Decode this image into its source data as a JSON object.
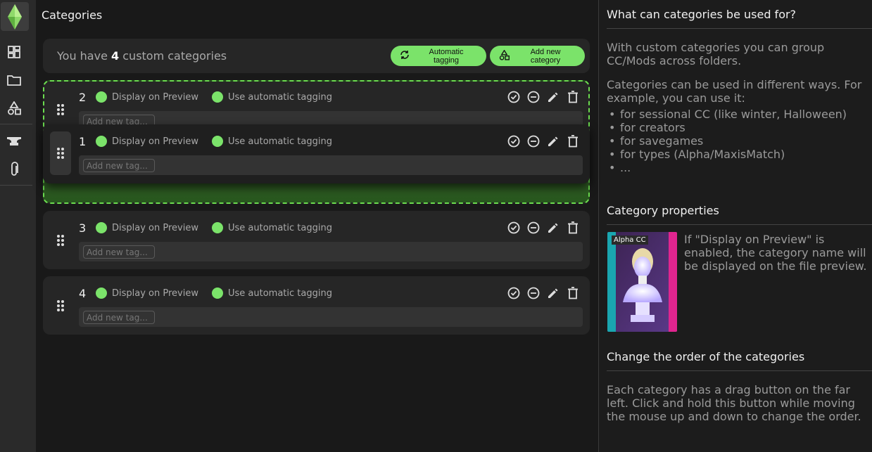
{
  "sidebar": {
    "icons": [
      "sims-logo-icon",
      "dashboard-icon",
      "folder-icon",
      "shapes-icon",
      "anvil-icon",
      "paperclip-icon"
    ]
  },
  "main": {
    "title": "Categories",
    "summary_prefix": "You have",
    "summary_count": "4",
    "summary_suffix": "custom categories",
    "auto_tag_label": "Automatic tagging",
    "add_category_label": "Add new category"
  },
  "categories": [
    {
      "number": "2",
      "display_label": "Display on Preview",
      "auto_label": "Use automatic tagging",
      "tag_placeholder": "Add new tag..."
    },
    {
      "number": "1",
      "display_label": "Display on Preview",
      "auto_label": "Use automatic tagging",
      "tag_placeholder": "Add new tag..."
    },
    {
      "number": "3",
      "display_label": "Display on Preview",
      "auto_label": "Use automatic tagging",
      "tag_placeholder": "Add new tag..."
    },
    {
      "number": "4",
      "display_label": "Display on Preview",
      "auto_label": "Use automatic tagging",
      "tag_placeholder": "Add new tag..."
    }
  ],
  "help": {
    "h1": "What can categories be used for?",
    "p1": "With custom categories you can group CC/Mods across folders.",
    "p2": "Categories can be used in different ways. For example, you can use it:",
    "list": [
      "for sessional CC (like winter, Halloween)",
      "for creators",
      "for savegames",
      "for types (Alpha/MaxisMatch)",
      "..."
    ],
    "h2": "Category properties",
    "preview_badge": "Alpha CC",
    "p3": "If \"Display on Preview\" is enabled, the category name will be displayed on the file preview.",
    "h3": "Change the order of the categories",
    "p4": "Each category has a drag button on the far left. Click and hold this button while moving the mouse up and down to change the order."
  },
  "colors": {
    "accent": "#7be36a",
    "bg": "#191919",
    "card": "#262626"
  }
}
